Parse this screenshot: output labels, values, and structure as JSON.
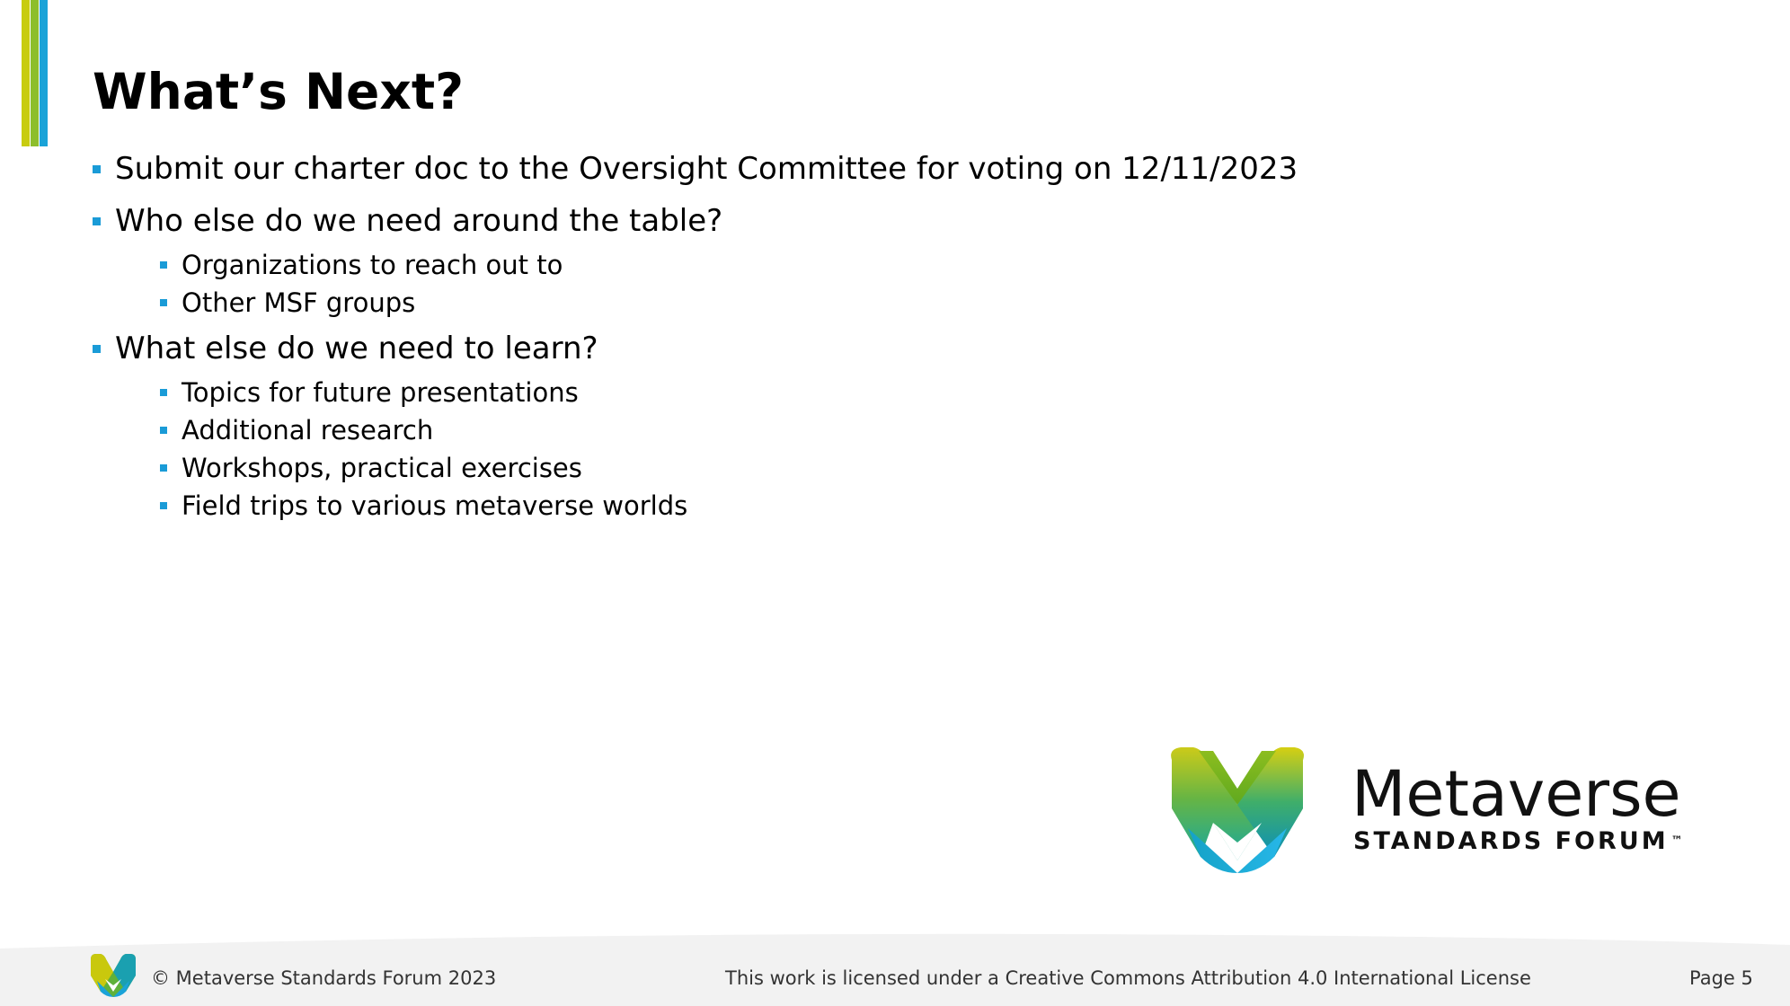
{
  "slide": {
    "title": "What’s Next?",
    "bullets": [
      {
        "text": "Submit our charter doc to the Oversight Committee for voting on 12/11/2023",
        "sub": []
      },
      {
        "text": "Who else do we need around the table?",
        "sub": [
          "Organizations to reach out to",
          "Other MSF groups"
        ]
      },
      {
        "text": "What else do we need to learn?",
        "sub": [
          "Topics for future presentations",
          "Additional research",
          "Workshops, practical exercises",
          "Field trips to various metaverse worlds"
        ]
      }
    ]
  },
  "logo": {
    "word": "Metaverse",
    "subtitle": "STANDARDS FORUM",
    "trademark": "™"
  },
  "footer": {
    "copyright": "© Metaverse Standards Forum 2023",
    "license": "This work is licensed under a Creative Commons Attribution 4.0 International License",
    "page": "Page 5"
  },
  "colors": {
    "bullet": "#1a9bd7",
    "accent_yellow": "#c8cc10",
    "accent_green": "#8dbe2c",
    "accent_blue": "#1aa3d8",
    "footer_bg": "#f2f2f2"
  }
}
